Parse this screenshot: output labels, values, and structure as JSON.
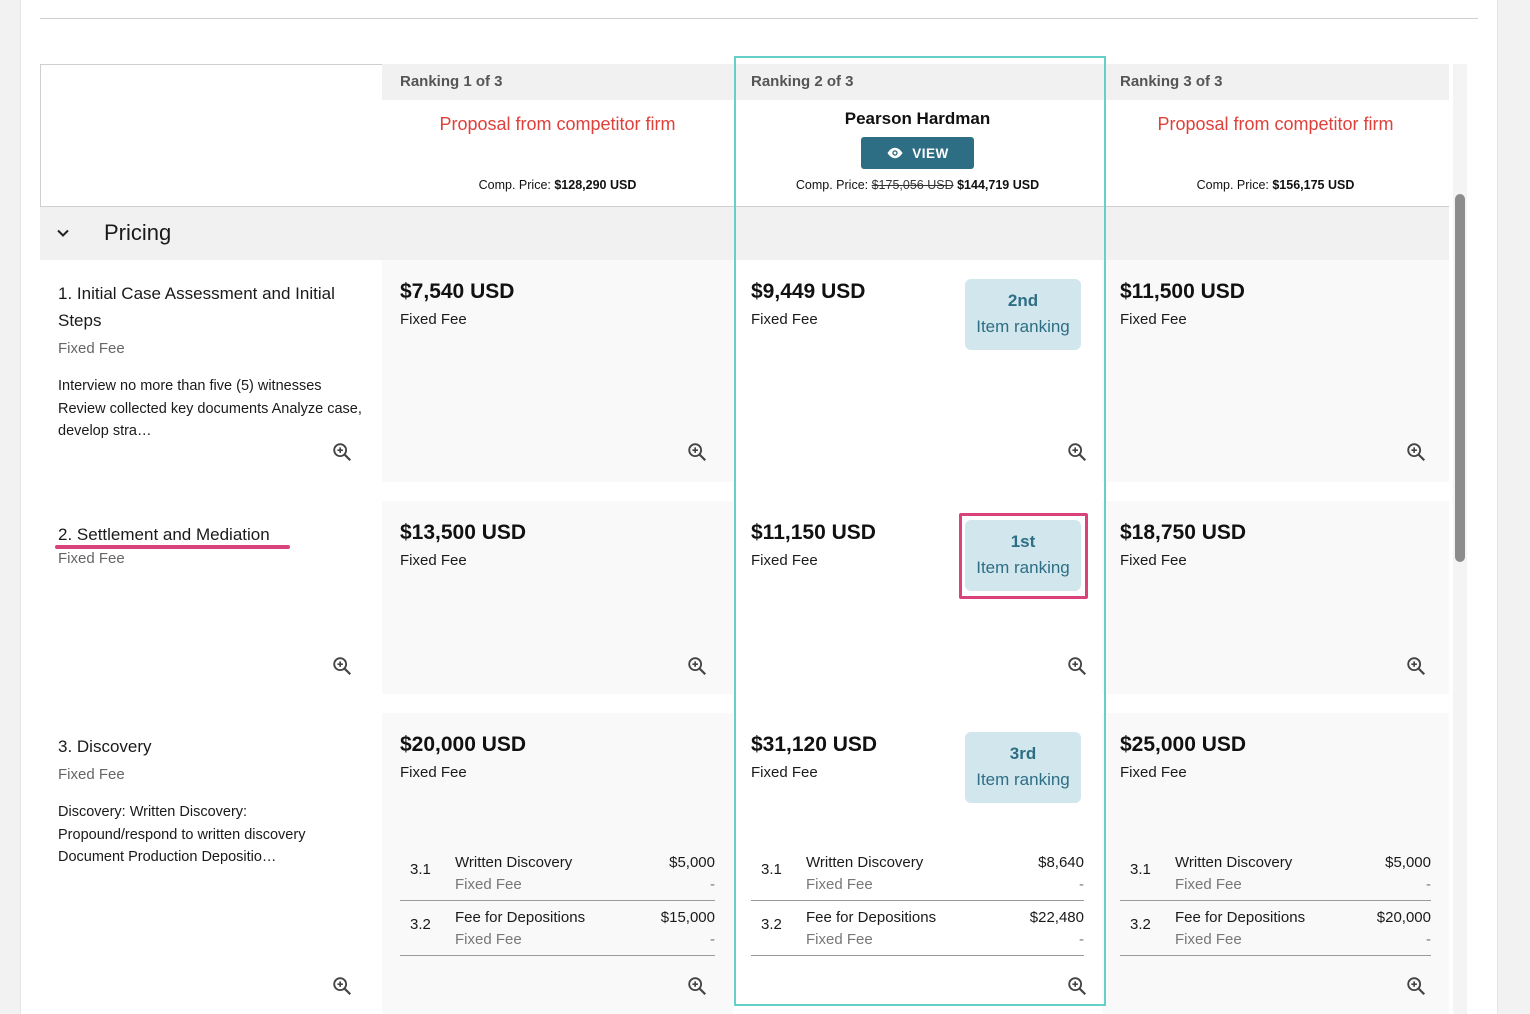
{
  "columns": [
    {
      "ranking": "Ranking 1 of 3",
      "firm": "Proposal from competitor firm",
      "firm_style": "competitor",
      "price_label": "Comp. Price:",
      "price": "$128,290 USD"
    },
    {
      "ranking": "Ranking 2 of 3",
      "firm": "Pearson Hardman",
      "firm_style": "own",
      "view_label": "VIEW",
      "price_label": "Comp. Price:",
      "old_price": "$175,056 USD",
      "price": "$144,719 USD"
    },
    {
      "ranking": "Ranking 3 of 3",
      "firm": "Proposal from competitor firm",
      "firm_style": "competitor",
      "price_label": "Comp. Price:",
      "price": "$156,175 USD"
    }
  ],
  "section": {
    "title": "Pricing",
    "expanded": true
  },
  "items": [
    {
      "title": "1. Initial Case Assessment and Initial Steps",
      "fee_type": "Fixed Fee",
      "description": "Interview no more than five (5) witnesses Review collected key documents Analyze case, develop stra…",
      "prices": [
        {
          "amount": "$7,540 USD",
          "fee": "Fixed Fee"
        },
        {
          "amount": "$9,449 USD",
          "fee": "Fixed Fee",
          "badge_pos": "2nd",
          "badge_label": "Item ranking"
        },
        {
          "amount": "$11,500 USD",
          "fee": "Fixed Fee"
        }
      ]
    },
    {
      "title": "2. Settlement and Mediation",
      "fee_type": "Fixed Fee",
      "description": "",
      "prices": [
        {
          "amount": "$13,500 USD",
          "fee": "Fixed Fee"
        },
        {
          "amount": "$11,150 USD",
          "fee": "Fixed Fee",
          "badge_pos": "1st",
          "badge_label": "Item ranking"
        },
        {
          "amount": "$18,750 USD",
          "fee": "Fixed Fee"
        }
      ]
    },
    {
      "title": "3. Discovery",
      "fee_type": "Fixed Fee",
      "description": "Discovery: Written Discovery: Propound/respond to written discovery Document Production Depositio…",
      "prices": [
        {
          "amount": "$20,000 USD",
          "fee": "Fixed Fee",
          "subs": [
            {
              "num": "3.1",
              "name": "Written Discovery",
              "fee": "Fixed Fee",
              "amount": "$5,000",
              "dash": "-"
            },
            {
              "num": "3.2",
              "name": "Fee for Depositions",
              "fee": "Fixed Fee",
              "amount": "$15,000",
              "dash": "-"
            }
          ]
        },
        {
          "amount": "$31,120 USD",
          "fee": "Fixed Fee",
          "badge_pos": "3rd",
          "badge_label": "Item ranking",
          "subs": [
            {
              "num": "3.1",
              "name": "Written Discovery",
              "fee": "Fixed Fee",
              "amount": "$8,640",
              "dash": "-"
            },
            {
              "num": "3.2",
              "name": "Fee for Depositions",
              "fee": "Fixed Fee",
              "amount": "$22,480",
              "dash": "-"
            }
          ]
        },
        {
          "amount": "$25,000 USD",
          "fee": "Fixed Fee",
          "subs": [
            {
              "num": "3.1",
              "name": "Written Discovery",
              "fee": "Fixed Fee",
              "amount": "$5,000",
              "dash": "-"
            },
            {
              "num": "3.2",
              "name": "Fee for Depositions",
              "fee": "Fixed Fee",
              "amount": "$20,000",
              "dash": "-"
            }
          ]
        }
      ]
    }
  ],
  "colors": {
    "accent": "#2e6e84",
    "competitor_text": "#e0403a",
    "badge_bg": "#d2e6ee",
    "highlight": "#d8437c",
    "selected_frame": "#66cfc8"
  }
}
